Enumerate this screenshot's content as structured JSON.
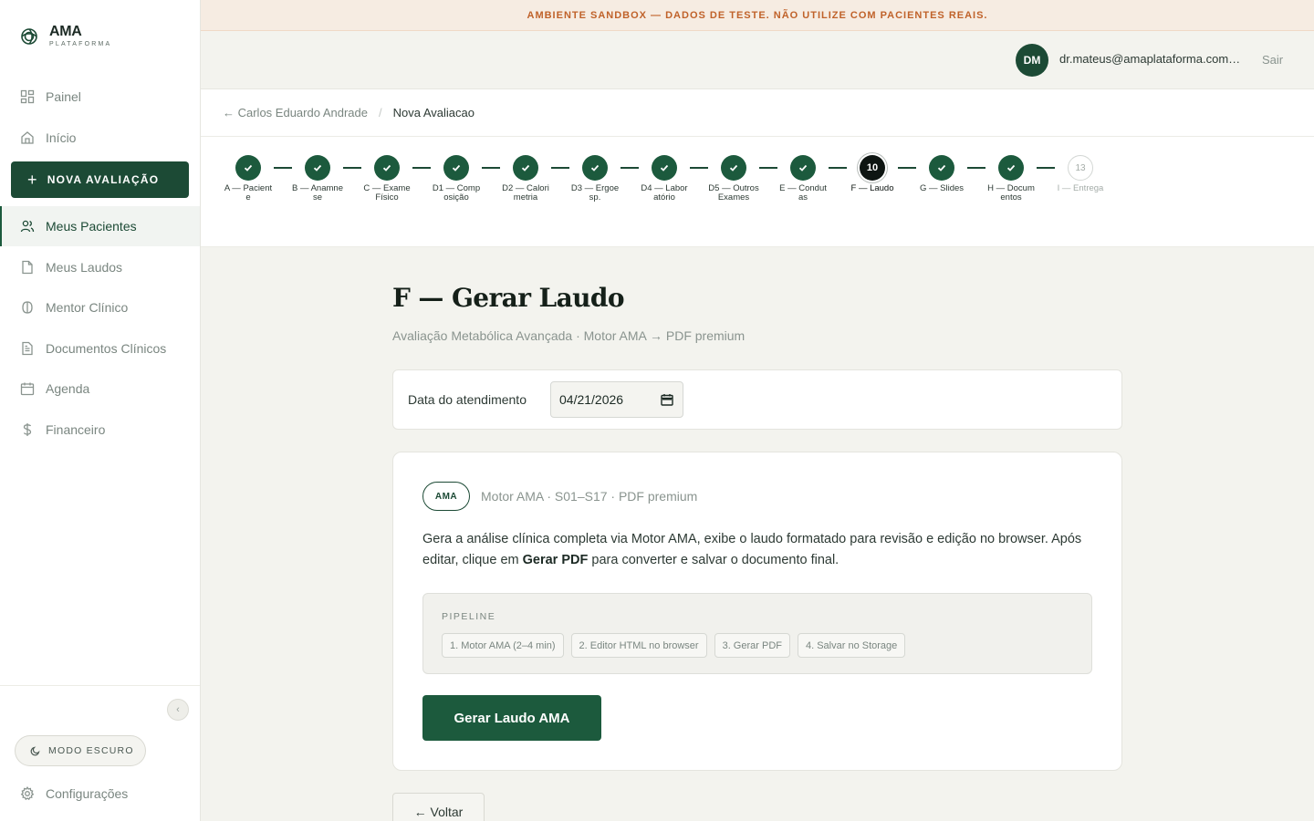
{
  "brand": {
    "name": "AMA",
    "tagline": "PLATAFORMA"
  },
  "sandbox_banner": "AMBIENTE SANDBOX — DADOS DE TESTE. NÃO UTILIZE COM PACIENTES REAIS.",
  "sidebar": {
    "items": [
      {
        "label": "Painel",
        "icon": "grid-icon"
      },
      {
        "label": "Início",
        "icon": "home-icon"
      },
      {
        "label": "Meus Pacientes",
        "icon": "users-icon",
        "active": true
      },
      {
        "label": "Meus Laudos",
        "icon": "file-icon"
      },
      {
        "label": "Mentor Clínico",
        "icon": "brain-icon"
      },
      {
        "label": "Documentos Clínicos",
        "icon": "document-icon"
      },
      {
        "label": "Agenda",
        "icon": "calendar-icon"
      },
      {
        "label": "Financeiro",
        "icon": "dollar-icon"
      }
    ],
    "new_button": "NOVA AVALIAÇÃO",
    "dark_mode": "MODO ESCURO",
    "settings": "Configurações"
  },
  "header": {
    "avatar_initials": "DM",
    "user_email": "dr.mateus@amaplataforma.com.br",
    "logout": "Sair"
  },
  "breadcrumb": {
    "back": "← Carlos Eduardo Andrade",
    "separator": "/",
    "current": "Nova Avaliacao"
  },
  "stepper": {
    "steps": [
      {
        "label": "A — Paciente",
        "status": "done"
      },
      {
        "label": "B — Anamnese",
        "status": "done"
      },
      {
        "label": "C — Exame Físico",
        "status": "done"
      },
      {
        "label": "D1 — Composição",
        "status": "done"
      },
      {
        "label": "D2 — Calorimetria",
        "status": "done"
      },
      {
        "label": "D3 — Ergoesp.",
        "status": "done"
      },
      {
        "label": "D4 — Laboratório",
        "status": "done"
      },
      {
        "label": "D5 — Outros Exames",
        "status": "done"
      },
      {
        "label": "E — Condutas",
        "status": "done"
      },
      {
        "label": "F — Laudo",
        "status": "current",
        "number": "10"
      },
      {
        "label": "G — Slides",
        "status": "done"
      },
      {
        "label": "H — Documentos",
        "status": "done"
      },
      {
        "label": "I — Entrega",
        "status": "pending",
        "number": "13"
      }
    ]
  },
  "main": {
    "title": "F — Gerar Laudo",
    "subtitle": "Avaliação Metabólica Avançada · Motor AMA → PDF premium",
    "date_label": "Data do atendimento",
    "date_value": "04/21/2026",
    "badge": "AMA",
    "badge_meta": "Motor AMA · S01–S17 · PDF premium",
    "desc_part1": "Gera a análise clínica completa via Motor AMA, exibe o laudo formatado para revisão e edição no browser. Após editar, clique em ",
    "desc_bold": "Gerar PDF",
    "desc_part2": " para converter e salvar o documento final.",
    "pipeline_label": "PIPELINE",
    "pipeline_steps": [
      "1. Motor AMA (2–4 min)",
      "2. Editor HTML no browser",
      "3. Gerar PDF",
      "4. Salvar no Storage"
    ],
    "generate_button": "Gerar Laudo AMA",
    "back_button": "← Voltar"
  }
}
